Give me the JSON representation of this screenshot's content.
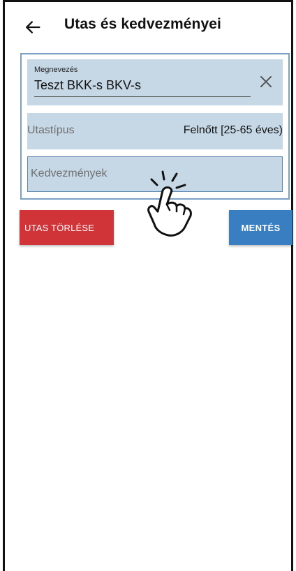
{
  "app_bar": {
    "back_icon": "arrow-left-icon",
    "title": "Utas és kedvezményei"
  },
  "form": {
    "name_field": {
      "label": "Megnevezés",
      "value": "Teszt BKK-s BKV-s",
      "clear_icon": "close-icon"
    },
    "type_field": {
      "label": "Utastípus",
      "value": "Felnőtt [25-65 éves)"
    },
    "discount_field": {
      "placeholder": "Kedvezmények"
    }
  },
  "gesture": {
    "icon": "tap-hand-icon"
  },
  "actions": {
    "delete_label": "UTAS TÖRLÉSE",
    "save_label": "MENTÉS"
  },
  "colors": {
    "field_bg": "#c6d8e6",
    "panel_border": "#7aa0c6",
    "delete_bg": "#d13438",
    "save_bg": "#3a7ec2"
  }
}
